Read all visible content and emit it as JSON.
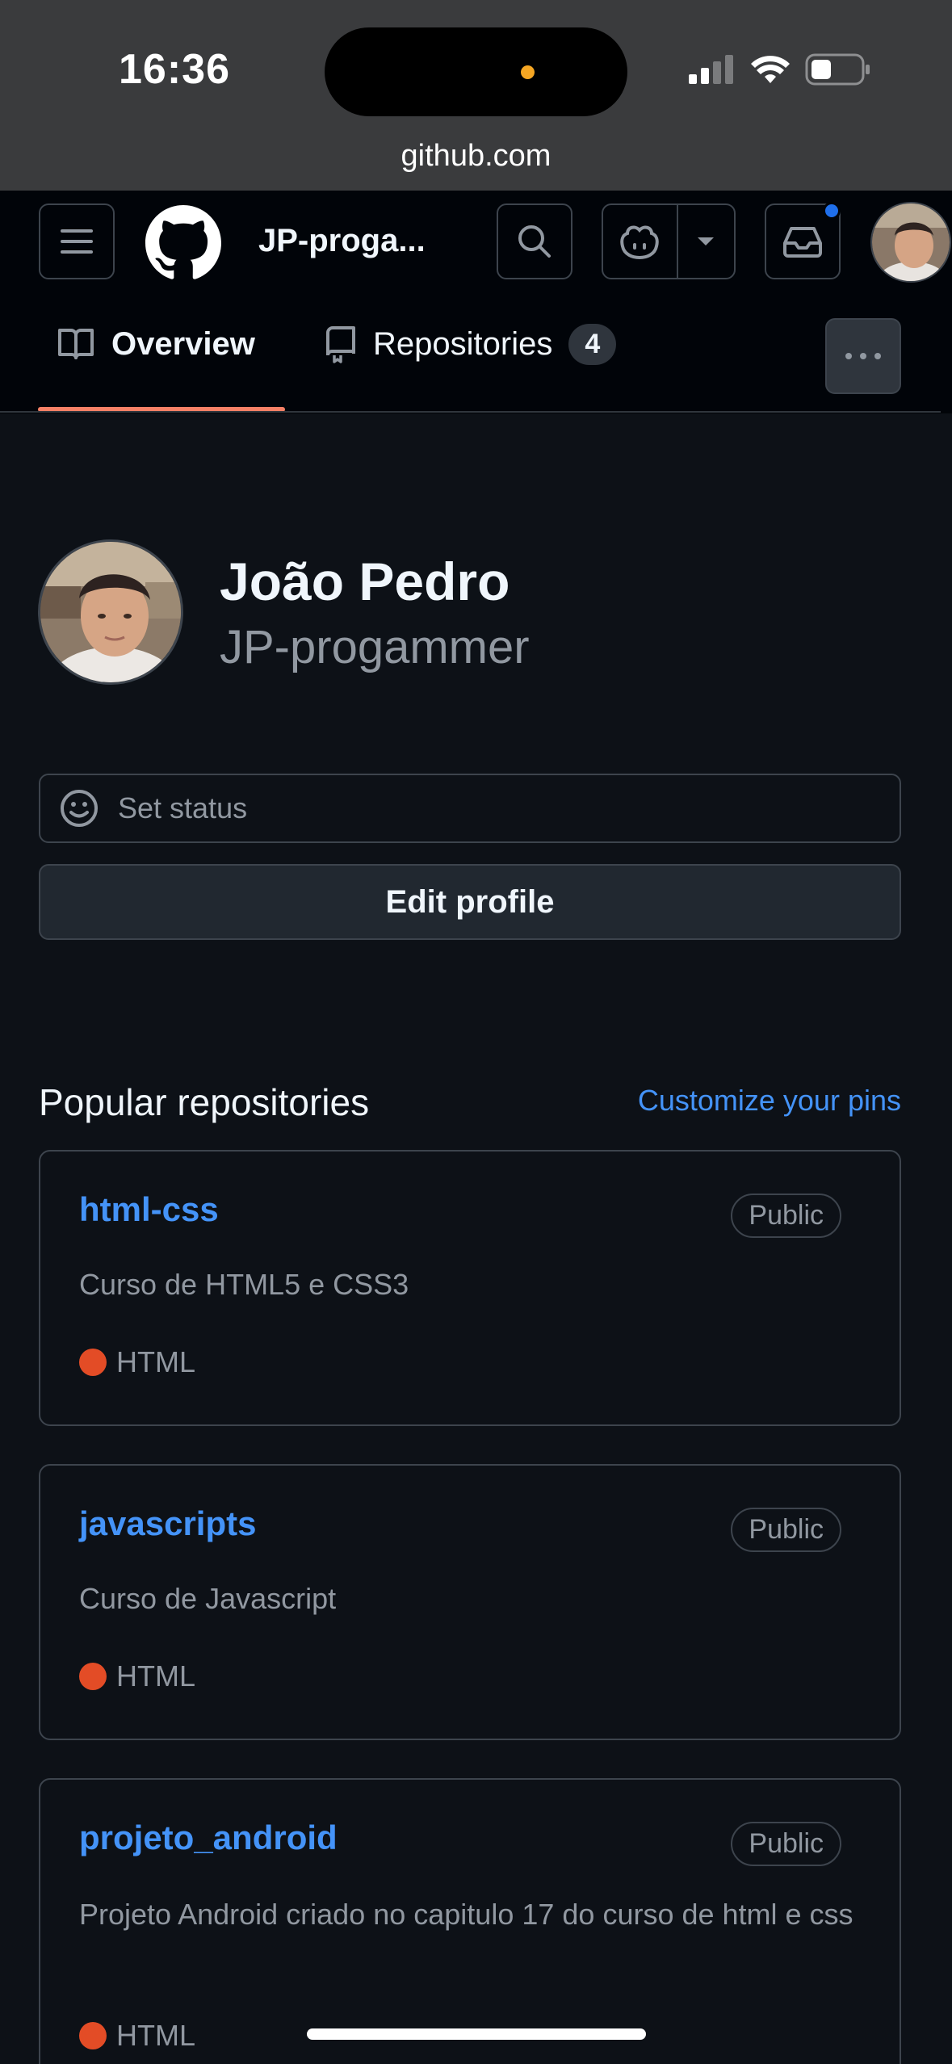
{
  "status_bar": {
    "time": "16:36"
  },
  "browser": {
    "url": "github.com"
  },
  "header": {
    "repo_title": "JP-proga..."
  },
  "tabs": [
    {
      "label": "Overview"
    },
    {
      "label": "Repositories",
      "count": "4"
    }
  ],
  "profile": {
    "name": "João Pedro",
    "login": "JP-progammer",
    "status_placeholder": "Set status",
    "edit_button": "Edit profile"
  },
  "popular": {
    "title": "Popular repositories",
    "customize": "Customize your pins",
    "repos": [
      {
        "name": "html-css",
        "visibility": "Public",
        "description": "Curso de HTML5 e CSS3",
        "language": "HTML"
      },
      {
        "name": "javascripts",
        "visibility": "Public",
        "description": "Curso de Javascript",
        "language": "HTML"
      },
      {
        "name": "projeto_android",
        "visibility": "Public",
        "description": "Projeto Android criado no capitulo 17 do curso de html e css",
        "language": "HTML"
      }
    ]
  },
  "colors": {
    "accent": "#4493f8",
    "tab_underline": "#f78166",
    "html_lang": "#e34c26",
    "notification": "#1f6feb",
    "background": "#0d1117"
  }
}
